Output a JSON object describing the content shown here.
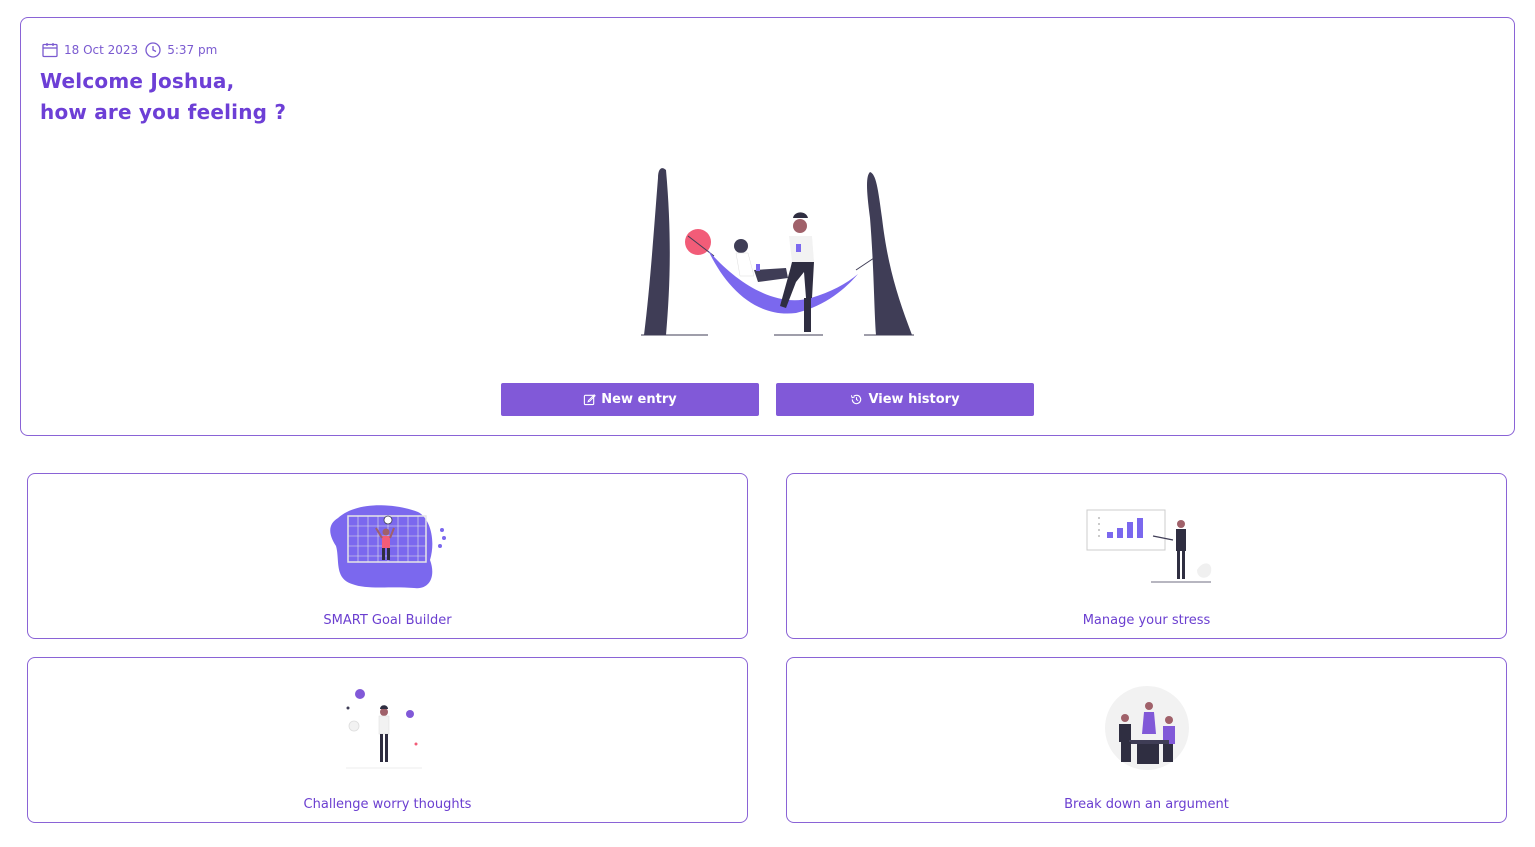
{
  "header": {
    "date": "18 Oct 2023",
    "time": "5:37 pm",
    "date_icon": "calendar-icon",
    "time_icon": "clock-icon",
    "greeting_line1": "Welcome Joshua,",
    "greeting_line2": "how are you feeling ?"
  },
  "actions": {
    "new_entry_label": "New entry",
    "new_entry_icon": "edit-icon",
    "view_history_label": "View history",
    "view_history_icon": "history-icon"
  },
  "cards": [
    {
      "label": "SMART Goal Builder"
    },
    {
      "label": "Manage your stress"
    },
    {
      "label": "Challenge worry thoughts"
    },
    {
      "label": "Break down an argument"
    }
  ],
  "colors": {
    "accent": "#8159d8",
    "text": "#6b3fd0",
    "border": "#8a63d6",
    "dark": "#3f3d56",
    "pink": "#f25c78"
  }
}
